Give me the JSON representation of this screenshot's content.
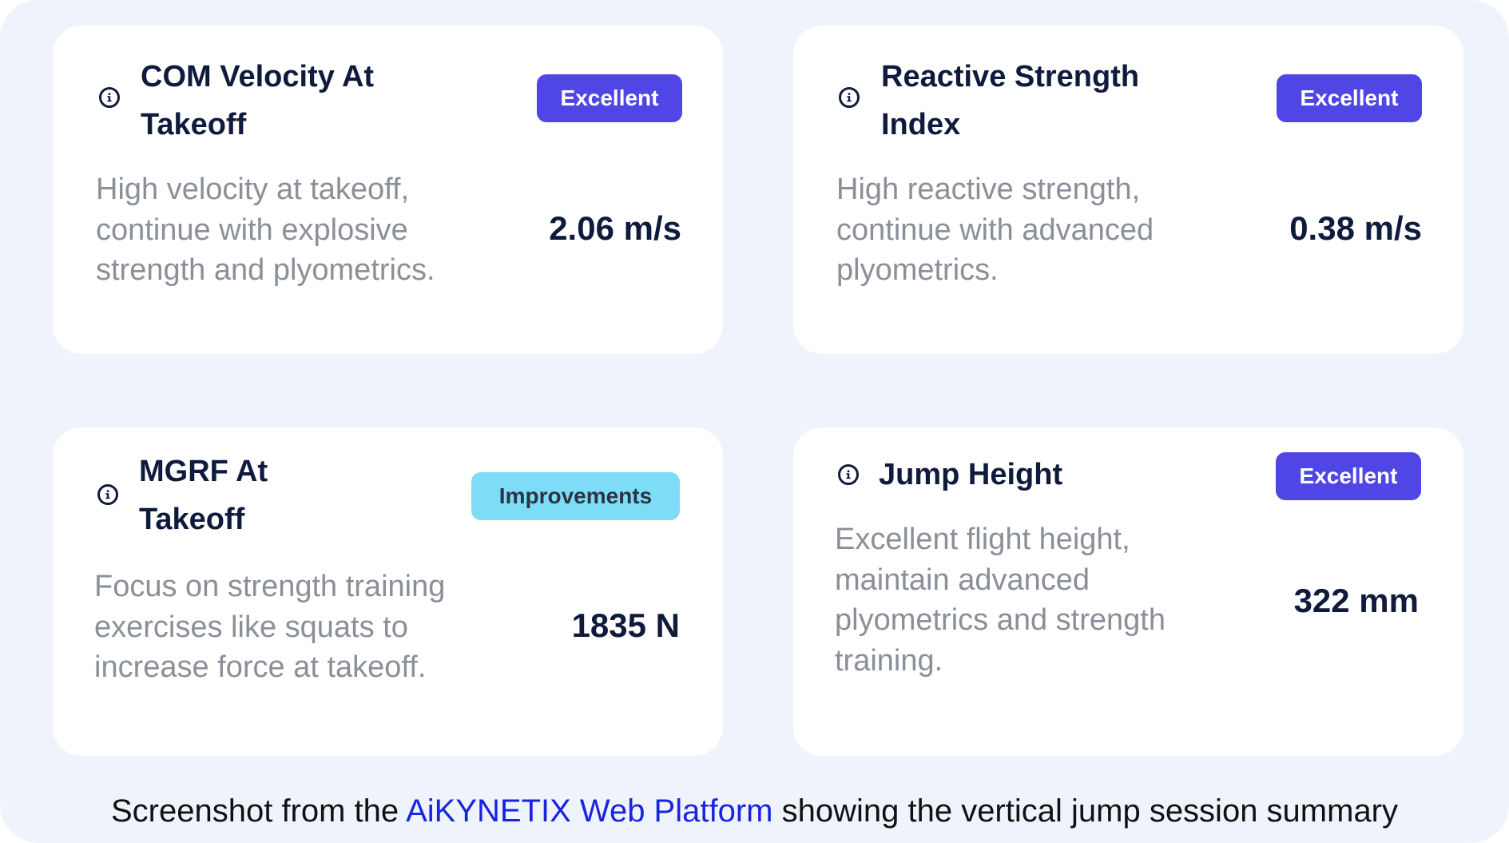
{
  "cards": [
    {
      "title_line1": "COM Velocity At",
      "title_line2": "Takeoff",
      "badge": "Excellent",
      "description_lines": [
        "High velocity at takeoff,",
        "continue with explosive",
        "strength and plyometrics."
      ],
      "value": "2.06 m/s"
    },
    {
      "title_line1": "Reactive Strength",
      "title_line2": "Index",
      "badge": "Excellent",
      "description_lines": [
        "High reactive strength,",
        "continue with advanced",
        "plyometrics."
      ],
      "value": "0.38 m/s"
    },
    {
      "title_line1": "MGRF At",
      "title_line2": "Takeoff",
      "badge": "Improvements",
      "description_lines": [
        "Focus on strength training",
        "exercises like squats to",
        "increase force at takeoff."
      ],
      "value": "1835 N"
    },
    {
      "title_line1": "Jump Height",
      "badge": "Excellent",
      "description_lines": [
        "Excellent flight height,",
        "maintain advanced",
        "plyometrics and strength",
        "training."
      ],
      "value": "322 mm"
    }
  ],
  "caption": {
    "prefix": "Screenshot from the ",
    "link": "AiKYNETIX Web Platform",
    "suffix": " showing the vertical jump session summary"
  },
  "icons": {
    "info": "info-circle-icon"
  },
  "colors": {
    "badge_excellent": "#4f46e5",
    "badge_improvements": "#7ddcf6",
    "link": "#1a23e0",
    "background": "#eff4fc",
    "text_dark": "#0f1b3d",
    "text_muted": "#8a8f98"
  }
}
